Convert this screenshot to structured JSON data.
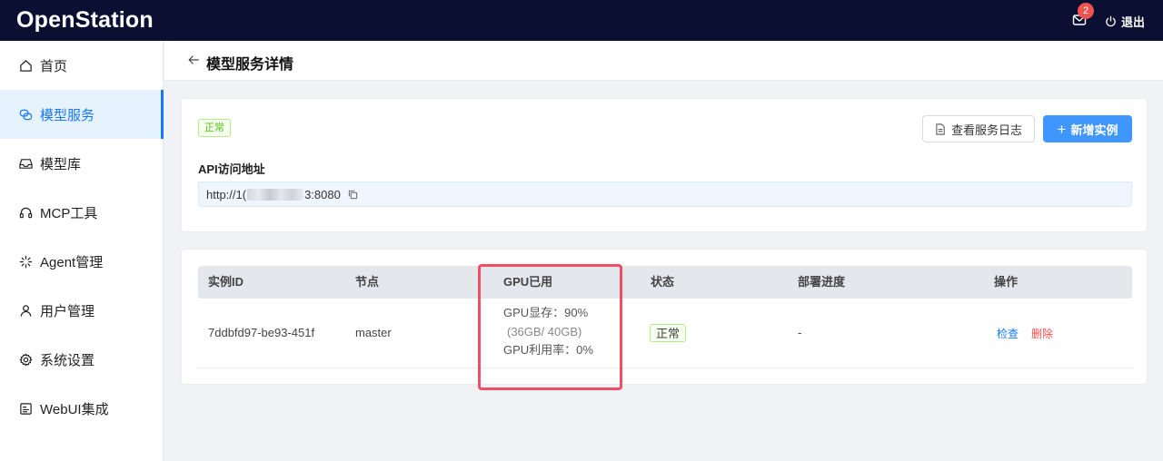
{
  "app": {
    "title": "OpenStation"
  },
  "topbar": {
    "notification_count": "2",
    "logout_label": "退出"
  },
  "sidebar": {
    "items": [
      {
        "label": "首页",
        "icon": "home-icon",
        "active": false
      },
      {
        "label": "模型服务",
        "icon": "chat-icon",
        "active": true
      },
      {
        "label": "模型库",
        "icon": "inbox-icon",
        "active": false
      },
      {
        "label": "MCP工具",
        "icon": "headset-icon",
        "active": false
      },
      {
        "label": "Agent管理",
        "icon": "sparkle-icon",
        "active": false
      },
      {
        "label": "用户管理",
        "icon": "user-icon",
        "active": false
      },
      {
        "label": "系统设置",
        "icon": "gear-icon",
        "active": false
      },
      {
        "label": "WebUI集成",
        "icon": "dashboard-icon",
        "active": false
      }
    ]
  },
  "page": {
    "title": "模型服务详情"
  },
  "service": {
    "status": "正常",
    "view_log_label": "查看服务日志",
    "add_instance_label": "新增实例",
    "api_label": "API访问地址",
    "api_url_prefix": "http://1(",
    "api_url_suffix": "3:8080"
  },
  "table": {
    "headers": {
      "id": "实例ID",
      "node": "节点",
      "gpu": "GPU已用",
      "status": "状态",
      "progress": "部署进度",
      "actions": "操作"
    },
    "rows": [
      {
        "id": "7ddbfd97-be93-451f",
        "node": "master",
        "gpu_mem": "GPU显存：90%",
        "gpu_mem_detail": "(36GB/ 40GB)",
        "gpu_util": "GPU利用率：0%",
        "status": "正常",
        "progress": "-",
        "action_inspect": "检查",
        "action_delete": "删除"
      }
    ]
  },
  "colors": {
    "topbar": "#0b1033",
    "accent": "#1677ff",
    "success": "#52c41a",
    "danger": "#ff4d4f",
    "highlight": "#ee4f65"
  }
}
